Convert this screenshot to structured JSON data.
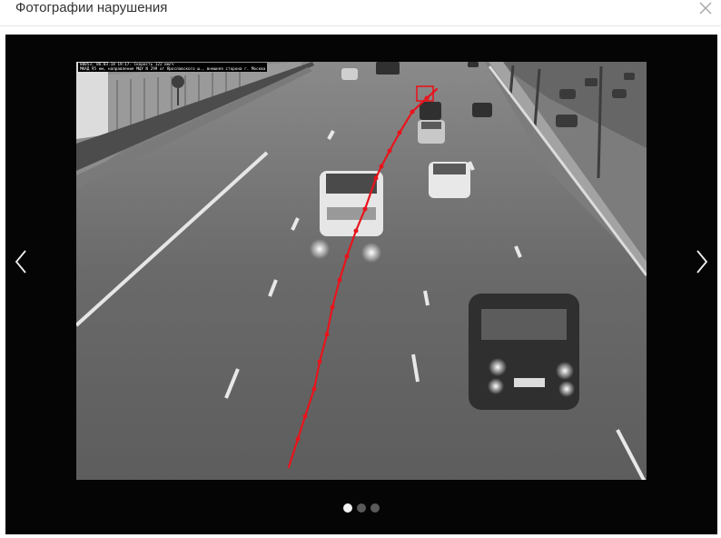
{
  "dialog": {
    "title": "Фотографии нарушения",
    "close_icon": "close-icon"
  },
  "viewer": {
    "background": "#050505",
    "prev_icon": "chevron-left-icon",
    "next_icon": "chevron-right-icon",
    "photo": {
      "overlay_line1": "00053, 06.03.18 19:17. Скорость 122 км/ч",
      "overlay_line2": "МКАД 95 км, направление МЦУ N 299 от Ярославского ш., внешняя сторона г. Москва",
      "track_color": "#e8141b"
    },
    "pagination": {
      "total": 3,
      "active_index": 0
    }
  }
}
